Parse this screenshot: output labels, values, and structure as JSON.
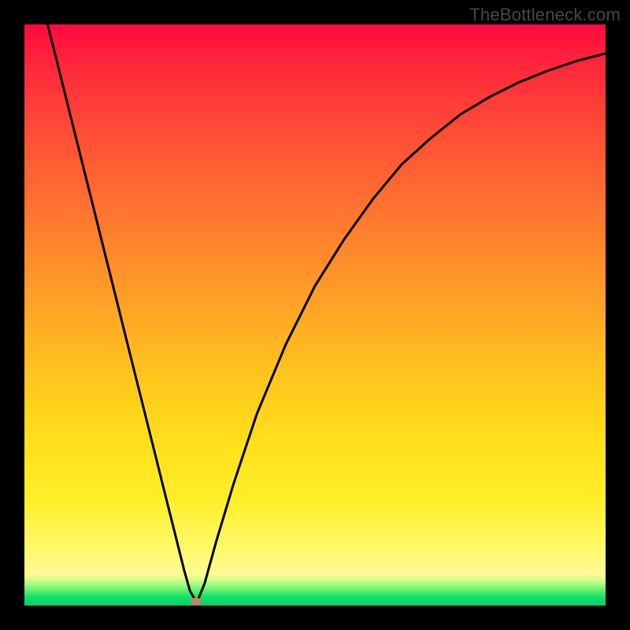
{
  "watermark": "TheBottleneck.com",
  "chart_data": {
    "type": "line",
    "title": "",
    "xlabel": "",
    "ylabel": "",
    "xlim": [
      0,
      100
    ],
    "ylim": [
      0,
      100
    ],
    "grid": false,
    "series": [
      {
        "name": "curve",
        "x": [
          4,
          6,
          8,
          10,
          12,
          14,
          16,
          18,
          20,
          22,
          24,
          26,
          27.5,
          28.5,
          29.5,
          30,
          31,
          33,
          36,
          40,
          45,
          50,
          55,
          60,
          65,
          70,
          75,
          80,
          85,
          90,
          95,
          100
        ],
        "y": [
          100,
          92,
          84,
          76,
          68,
          60,
          52,
          44,
          36,
          28,
          20,
          12,
          6,
          2.5,
          0.8,
          1.3,
          3.8,
          11,
          21,
          33,
          45,
          55,
          63,
          70,
          76,
          80.5,
          84.5,
          87.5,
          90,
          92,
          93.7,
          95
        ]
      }
    ],
    "marker": {
      "x_pct": 29.5,
      "y_pct": 0.7,
      "color": "#cd7a69"
    },
    "gradient_stops": [
      {
        "pct": 0,
        "color": "#ff0a3f"
      },
      {
        "pct": 50,
        "color": "#ffa226"
      },
      {
        "pct": 90,
        "color": "#fff96a"
      },
      {
        "pct": 100,
        "color": "#00d168"
      }
    ]
  }
}
